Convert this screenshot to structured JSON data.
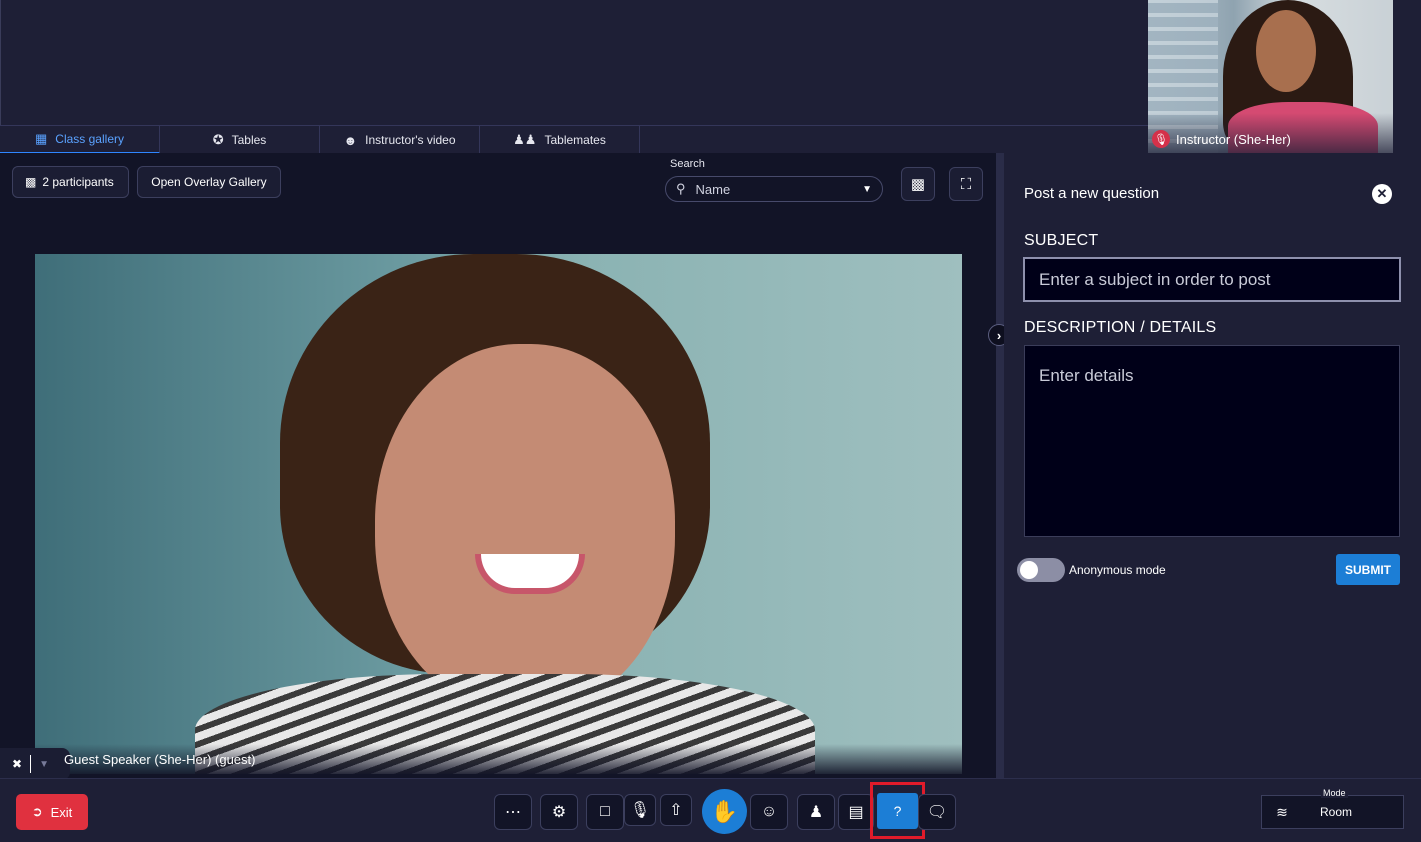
{
  "instructor": {
    "label": "Instructor (She-Her)"
  },
  "tabs": [
    {
      "label": "Class gallery",
      "icon": "grid-icon",
      "active": true
    },
    {
      "label": "Tables",
      "icon": "tables-icon"
    },
    {
      "label": "Instructor's video",
      "icon": "instructor-video-icon"
    },
    {
      "label": "Tablemates",
      "icon": "people-icon"
    }
  ],
  "gallery": {
    "participants_label": "2 participants",
    "overlay_button": "Open Overlay Gallery",
    "search_label": "Search",
    "search_value": "Name",
    "speaker_label": "Guest Speaker (She-Her) (guest)"
  },
  "question_panel": {
    "title": "Post a new question",
    "subject_label": "SUBJECT",
    "subject_placeholder": "Enter a subject in order to post",
    "details_label": "DESCRIPTION / DETAILS",
    "details_placeholder": "Enter details",
    "anonymous_label": "Anonymous mode",
    "anonymous_on": false,
    "submit_label": "SUBMIT"
  },
  "toolbar": {
    "exit_label": "Exit",
    "mode_caption": "Mode",
    "mode_value": "Room"
  },
  "colors": {
    "accent": "#1c7ed6",
    "exit": "#e0313f",
    "highlight": "#e01b2a"
  }
}
